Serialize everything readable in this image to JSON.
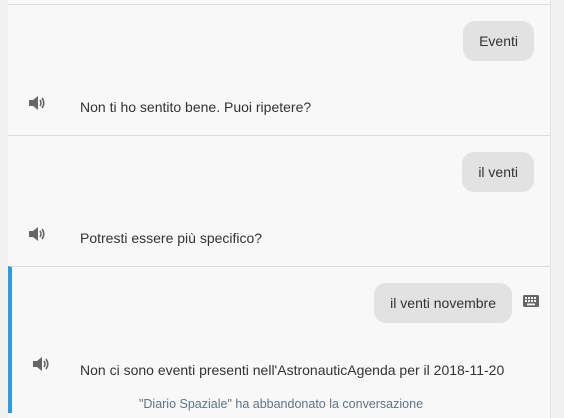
{
  "conversation": {
    "turns": [
      {
        "user": "Eventi",
        "reply": "Non ti ho sentito bene. Puoi ripetere?"
      },
      {
        "user": "il venti",
        "reply": "Potresti essere più specifico?"
      },
      {
        "user": "il venti novembre",
        "reply": "Non ci sono eventi presenti nell'AstronauticAgenda per il 2018-11-20"
      }
    ],
    "status": "\"Diario Spaziale\" ha abbandonato la conversazione"
  },
  "icons": {
    "reply_icon": "speaker-icon",
    "input_icon": "keyboard-icon"
  },
  "colors": {
    "active_bar": "#2a9ce6",
    "bubble": "#e2e2e2",
    "status_text": "#5f7383"
  }
}
